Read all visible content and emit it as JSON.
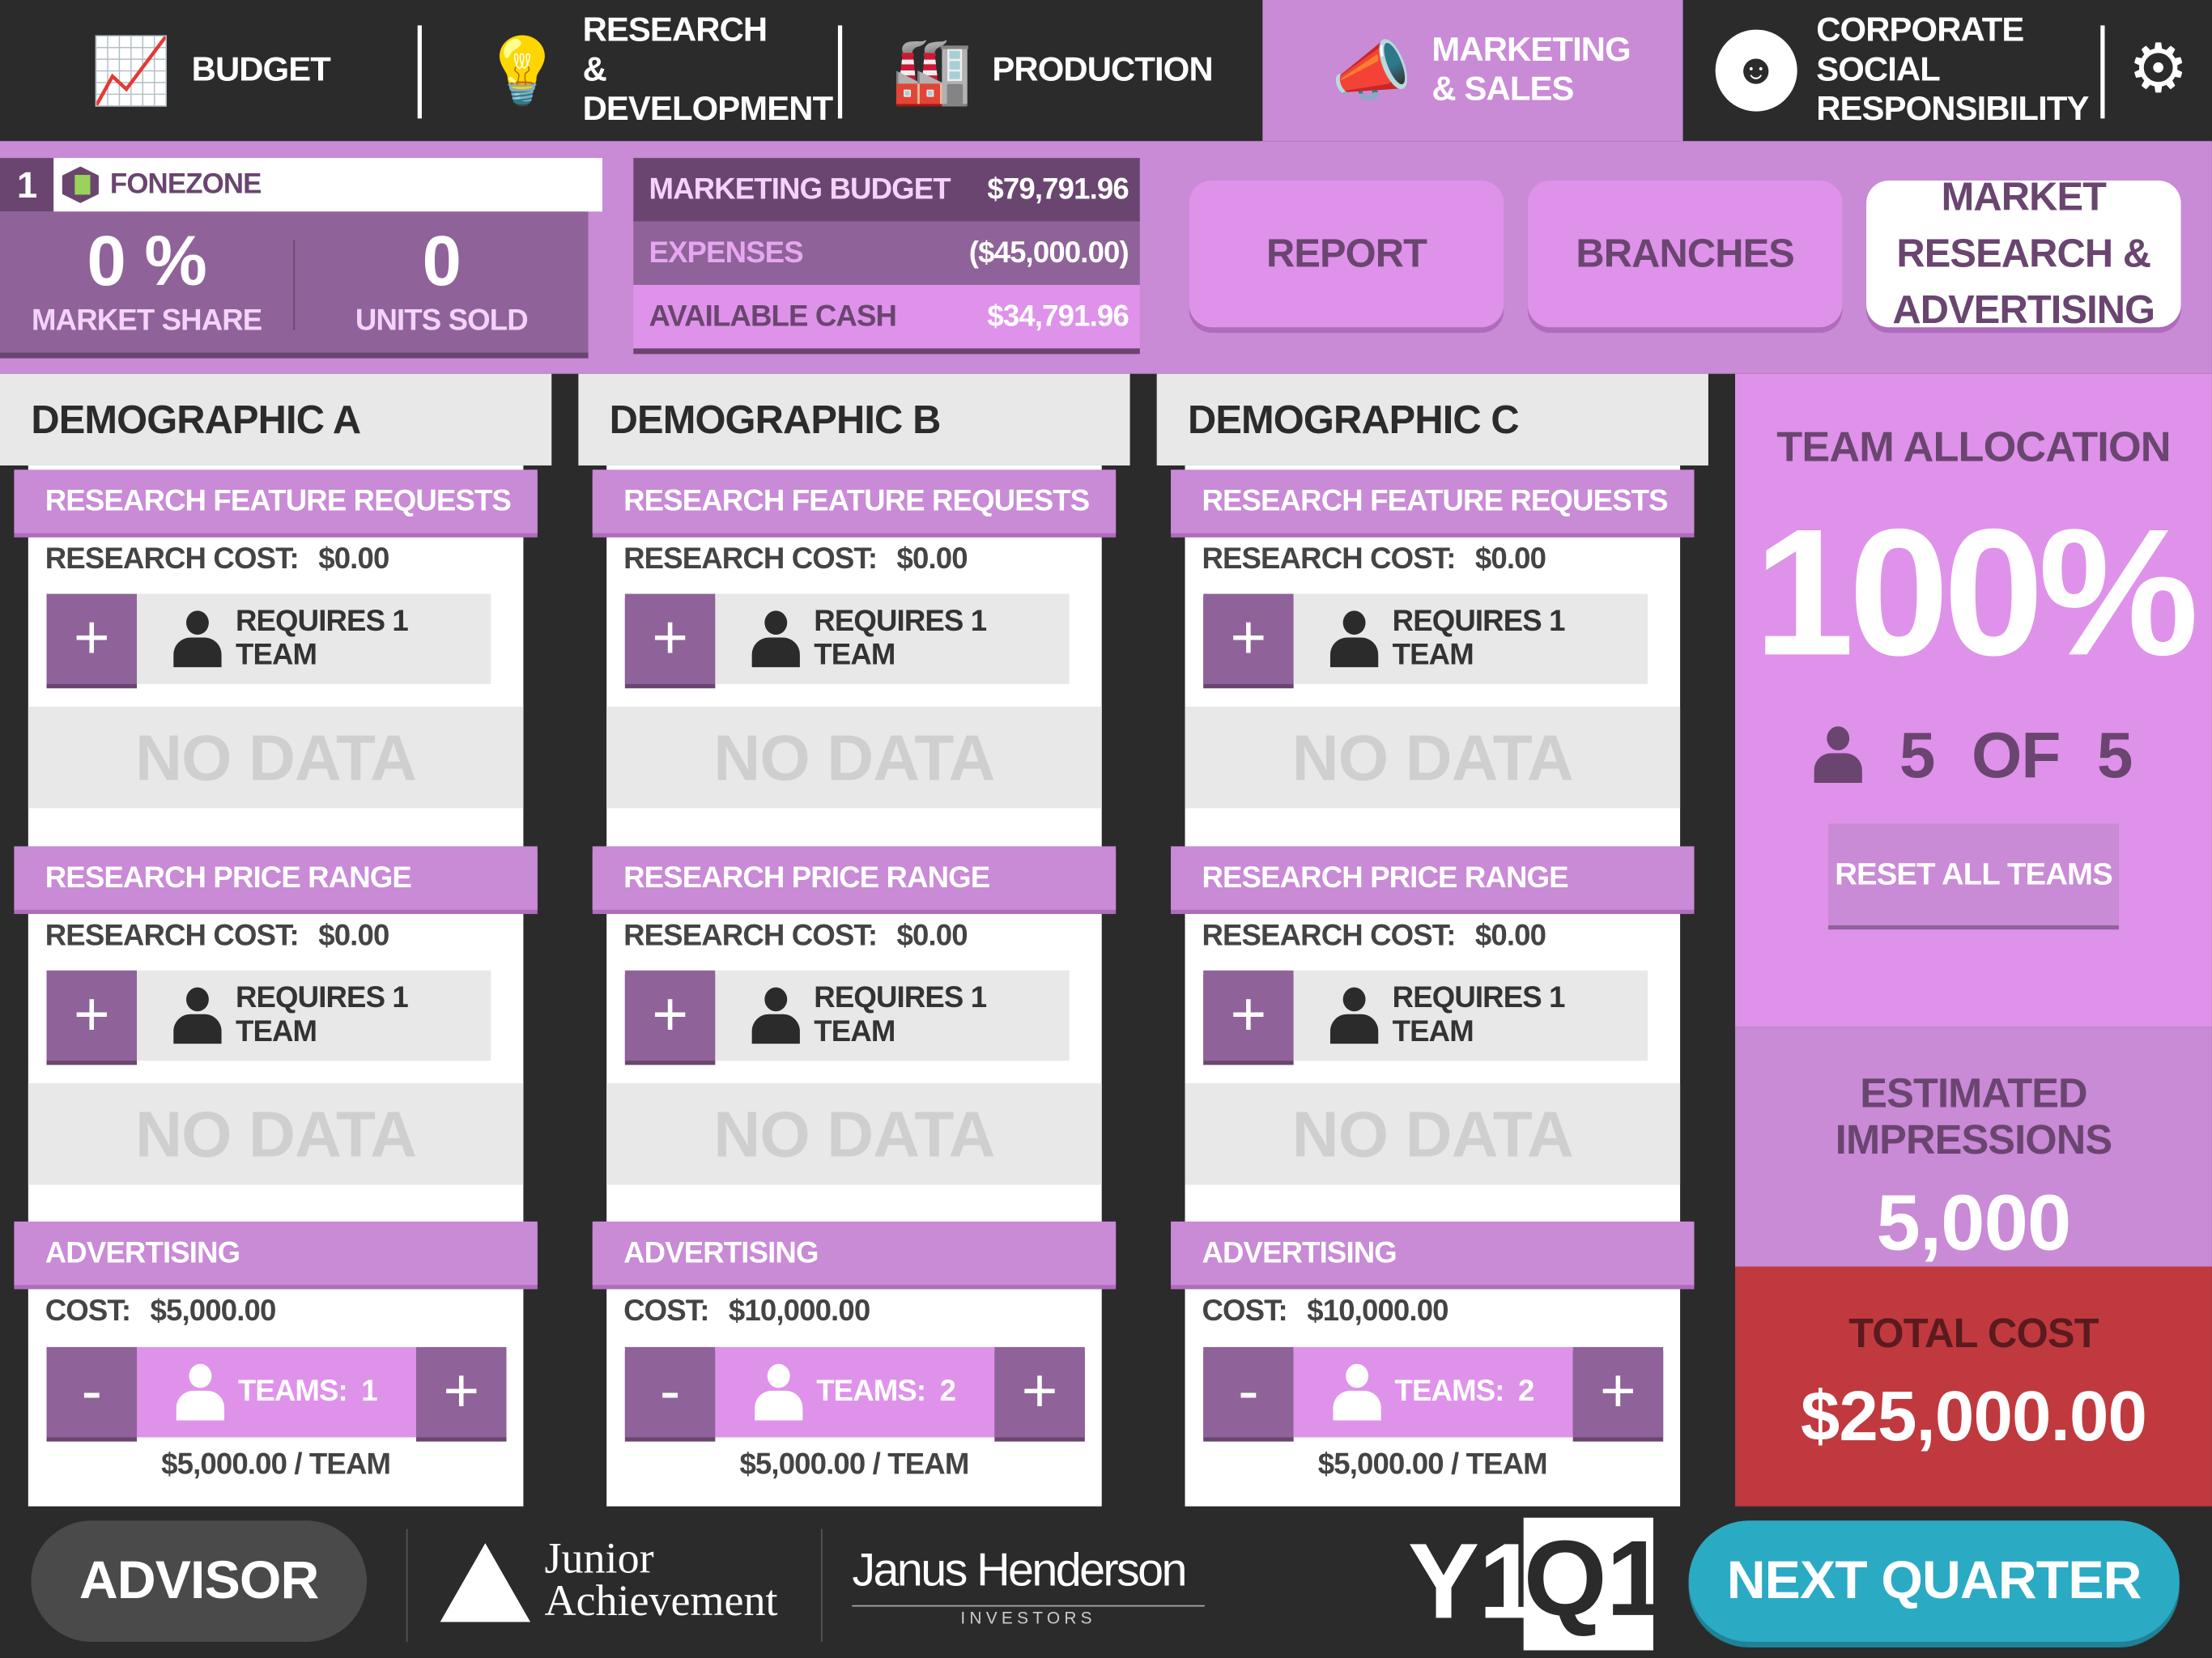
{
  "nav": {
    "tabs": [
      {
        "label": "BUDGET",
        "icon": "chart-growth-icon"
      },
      {
        "label": "RESEARCH & DEVELOPMENT",
        "icon": "lightbulb-icon"
      },
      {
        "label": "PRODUCTION",
        "icon": "factory-icon"
      },
      {
        "label": "MARKETING & SALES",
        "icon": "megaphone-icon",
        "active": true
      },
      {
        "label": "CORPORATE SOCIAL RESPONSIBILITY",
        "icon": "smiley-icon"
      }
    ],
    "settings_icon": "gear-icon"
  },
  "team": {
    "number": "1",
    "name": "FONEZONE",
    "market_share": "0 %",
    "market_share_label": "MARKET SHARE",
    "units_sold": "0",
    "units_sold_label": "UNITS SOLD"
  },
  "budget": {
    "rows": [
      {
        "label": "MARKETING BUDGET",
        "value": "$79,791.96"
      },
      {
        "label": "EXPENSES",
        "value": "($45,000.00)"
      },
      {
        "label": "AVAILABLE CASH",
        "value": "$34,791.96"
      }
    ]
  },
  "header_buttons": {
    "report": "REPORT",
    "branches": "BRANCHES",
    "market_research": "MARKET RESEARCH & ADVERTISING"
  },
  "demographics": [
    {
      "title": "DEMOGRAPHIC A",
      "feature": {
        "title": "RESEARCH FEATURE REQUESTS",
        "cost_label": "RESEARCH COST:",
        "cost": "$0.00",
        "requires": "REQUIRES 1 TEAM",
        "no_data": "NO DATA"
      },
      "price": {
        "title": "RESEARCH PRICE RANGE",
        "cost_label": "RESEARCH COST:",
        "cost": "$0.00",
        "requires": "REQUIRES 1 TEAM",
        "no_data": "NO DATA"
      },
      "advertising": {
        "title": "ADVERTISING",
        "cost_label": "COST:",
        "cost": "$5,000.00",
        "teams_label": "TEAMS:",
        "teams": "1",
        "per_team": "$5,000.00 / TEAM"
      }
    },
    {
      "title": "DEMOGRAPHIC B",
      "feature": {
        "title": "RESEARCH FEATURE REQUESTS",
        "cost_label": "RESEARCH COST:",
        "cost": "$0.00",
        "requires": "REQUIRES 1 TEAM",
        "no_data": "NO DATA"
      },
      "price": {
        "title": "RESEARCH PRICE RANGE",
        "cost_label": "RESEARCH COST:",
        "cost": "$0.00",
        "requires": "REQUIRES 1 TEAM",
        "no_data": "NO DATA"
      },
      "advertising": {
        "title": "ADVERTISING",
        "cost_label": "COST:",
        "cost": "$10,000.00",
        "teams_label": "TEAMS:",
        "teams": "2",
        "per_team": "$5,000.00 / TEAM"
      }
    },
    {
      "title": "DEMOGRAPHIC C",
      "feature": {
        "title": "RESEARCH FEATURE REQUESTS",
        "cost_label": "RESEARCH COST:",
        "cost": "$0.00",
        "requires": "REQUIRES 1 TEAM",
        "no_data": "NO DATA"
      },
      "price": {
        "title": "RESEARCH PRICE RANGE",
        "cost_label": "RESEARCH COST:",
        "cost": "$0.00",
        "requires": "REQUIRES 1 TEAM",
        "no_data": "NO DATA"
      },
      "advertising": {
        "title": "ADVERTISING",
        "cost_label": "COST:",
        "cost": "$10,000.00",
        "teams_label": "TEAMS:",
        "teams": "2",
        "per_team": "$5,000.00 / TEAM"
      }
    }
  ],
  "allocation": {
    "title": "TEAM ALLOCATION",
    "percent": "100%",
    "used": "5",
    "of": "OF",
    "total": "5",
    "reset": "RESET ALL TEAMS"
  },
  "impressions": {
    "title": "ESTIMATED IMPRESSIONS",
    "value": "5,000"
  },
  "total_cost": {
    "title": "TOTAL COST",
    "value": "$25,000.00"
  },
  "footer": {
    "advisor": "ADVISOR",
    "ja_logo": "Junior Achievement",
    "jh_logo": "Janus Henderson",
    "jh_sub": "INVESTORS",
    "year": "Y1",
    "quarter": "Q1",
    "next": "NEXT QUARTER"
  },
  "colors": {
    "accent": "#c98ad6",
    "light_accent": "#df92ea",
    "dark_purple": "#6a4570",
    "mid_purple": "#8f6399",
    "total_red": "#c0393f",
    "next_blue": "#2baac4"
  }
}
